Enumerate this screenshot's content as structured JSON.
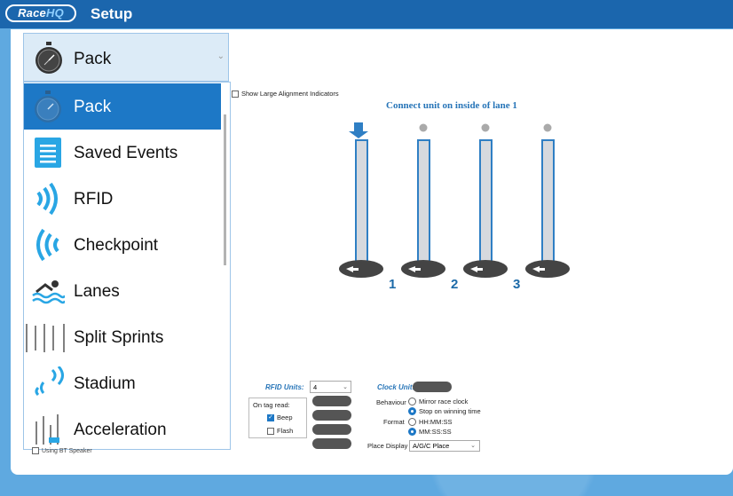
{
  "app": {
    "logo_left": "Race",
    "logo_right": "HQ",
    "title": "Setup"
  },
  "menu": {
    "selected_label": "Pack",
    "items": [
      {
        "label": "Pack",
        "icon": "stopwatch-icon",
        "selected": true
      },
      {
        "label": "Saved Events",
        "icon": "document-icon"
      },
      {
        "label": "RFID",
        "icon": "rfid-waves-icon"
      },
      {
        "label": "Checkpoint",
        "icon": "checkpoint-waves-icon"
      },
      {
        "label": "Lanes",
        "icon": "swimmer-icon"
      },
      {
        "label": "Split Sprints",
        "icon": "split-poles-icon"
      },
      {
        "label": "Stadium",
        "icon": "stadium-icon"
      },
      {
        "label": "Acceleration",
        "icon": "acceleration-icon"
      }
    ]
  },
  "main": {
    "show_large_alignment": "Show Large Alignment Indicators",
    "connect_text": "Connect unit on inside of lane 1",
    "lane_numbers": [
      "1",
      "2",
      "3"
    ]
  },
  "rfid": {
    "label": "RFID Units:",
    "units_value": "4",
    "on_tag_read": "On tag read:",
    "beep": "Beep",
    "beep_checked": true,
    "flash": "Flash",
    "flash_checked": false
  },
  "clock": {
    "label": "Clock Unit:",
    "behaviour_label": "Behaviour",
    "behaviour_opt1": "Mirror race clock",
    "behaviour_opt2": "Stop on winning time",
    "format_label": "Format",
    "format_opt1": "HH:MM:SS",
    "format_opt2": "MM:SS:SS",
    "place_display_label": "Place Display",
    "place_display_value": "A/G/C Place"
  },
  "footer": {
    "bt_speaker": "Using BT Speaker"
  },
  "colors": {
    "titlebar": "#1b66ad",
    "accent": "#1d78c6",
    "pole": "#2f7fc4"
  }
}
